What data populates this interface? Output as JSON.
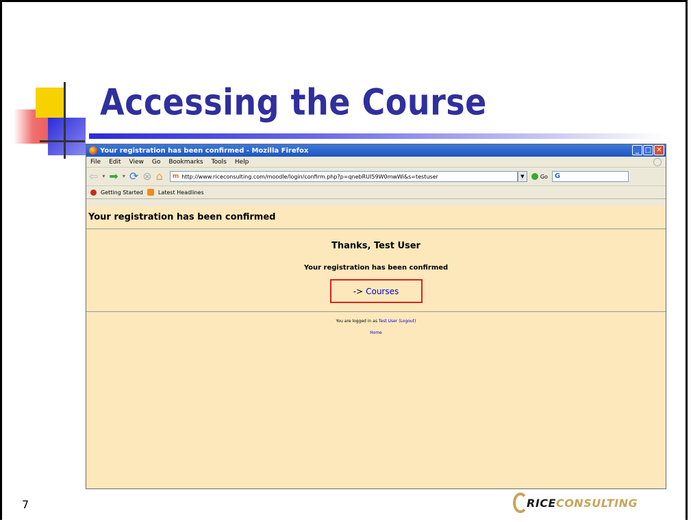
{
  "slide": {
    "title": "Accessing the Course",
    "page_number": "7"
  },
  "browser": {
    "window_title": "Your registration has been confirmed - Mozilla Firefox",
    "menu": [
      "File",
      "Edit",
      "View",
      "Go",
      "Bookmarks",
      "Tools",
      "Help"
    ],
    "url": "http://www.riceconsulting.com/moodle/login/confirm.php?p=qnebRUI59W0mwWi&s=testuser",
    "url_favicon": "m",
    "go_label": "Go",
    "search_glyph": "G",
    "bookmarks": [
      "Getting Started",
      "Latest Headlines"
    ]
  },
  "page": {
    "heading": "Your registration has been confirmed",
    "thanks": "Thanks, Test User",
    "confirmed": "Your registration has been confirmed",
    "courses_arrow": "->",
    "courses_link": "Courses",
    "logged_prefix": "You are logged in as",
    "user_link": "Test User",
    "logout_link": "(Logout)",
    "home_link": "Home"
  },
  "logo": {
    "part1": "RICE",
    "part2": "CONSULTING"
  },
  "colors": {
    "title": "#2f2f9e",
    "page_background": "#fde8bc",
    "highlight_box": "#e0201a",
    "link": "#0000d0"
  }
}
